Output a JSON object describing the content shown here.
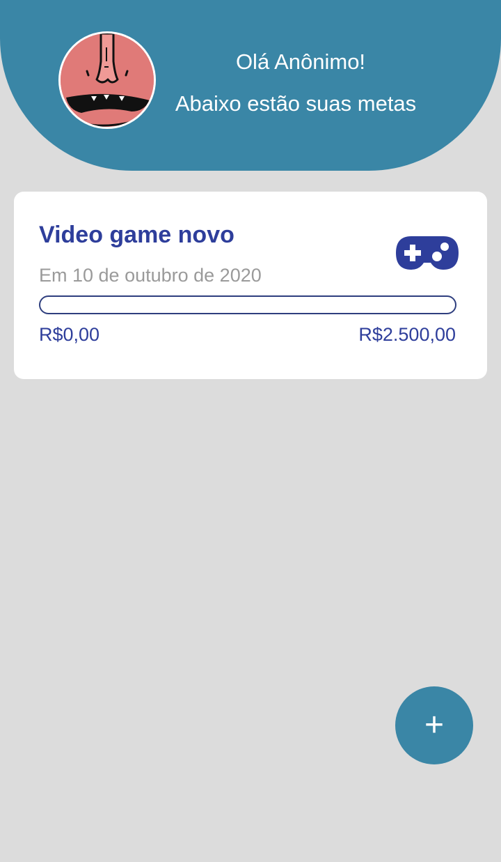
{
  "header": {
    "greeting": "Olá Anônimo!",
    "subtitle": "Abaixo estão suas metas",
    "avatar_icon": "cartoon-face-avatar",
    "background_color": "#3a86a6"
  },
  "goals": [
    {
      "title": "Video game novo",
      "date": "Em 10 de outubro de 2020",
      "icon": "gamepad-icon",
      "current_amount": "R$0,00",
      "target_amount": "R$2.500,00",
      "progress": 0
    }
  ],
  "fab": {
    "label": "+",
    "icon": "add-icon"
  },
  "colors": {
    "accent": "#2e3e9b",
    "header": "#3a86a6",
    "background": "#dcdcdc",
    "date_text": "#9a9a9a"
  }
}
